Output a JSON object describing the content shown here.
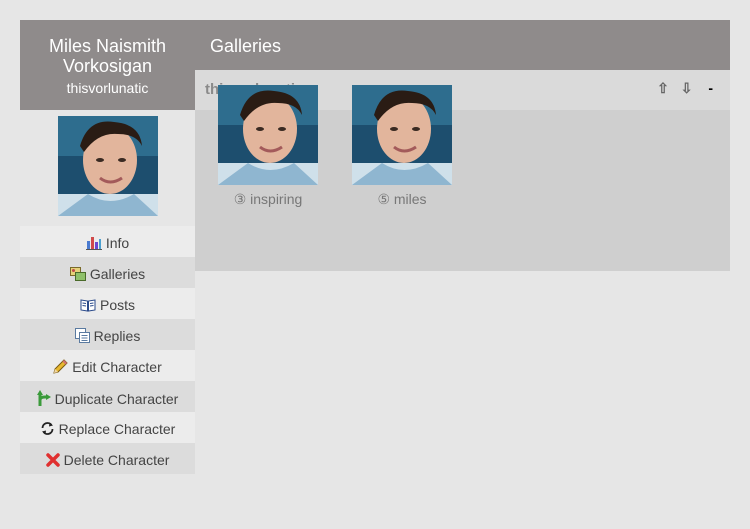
{
  "character": {
    "name": "Miles Naismith Vorkosigan",
    "screenname": "thisvorlunatic"
  },
  "sidebar": {
    "items": [
      {
        "label": "Info",
        "icon": "bar-chart-icon"
      },
      {
        "label": "Galleries",
        "icon": "galleries-icon"
      },
      {
        "label": "Posts",
        "icon": "book-icon"
      },
      {
        "label": "Replies",
        "icon": "replies-icon"
      },
      {
        "label": "Edit Character",
        "icon": "pencil-icon"
      },
      {
        "label": "Duplicate Character",
        "icon": "fork-arrow-icon"
      },
      {
        "label": "Replace Character",
        "icon": "refresh-icon"
      },
      {
        "label": "Delete Character",
        "icon": "red-x-icon"
      }
    ]
  },
  "main": {
    "title": "Galleries",
    "section_title": "thisvorlunatic",
    "controls": {
      "up": "⇧",
      "down": "⇩",
      "collapse": "-"
    },
    "galleries": [
      {
        "label": "③ inspiring"
      },
      {
        "label": "⑤ miles"
      }
    ]
  },
  "colors": {
    "header_bg": "#8f8b8b",
    "page_bg": "#e6e6e6",
    "panel_bg": "#cfcfcf",
    "menu_light": "#ececec",
    "menu_dark": "#dcdcdc"
  }
}
